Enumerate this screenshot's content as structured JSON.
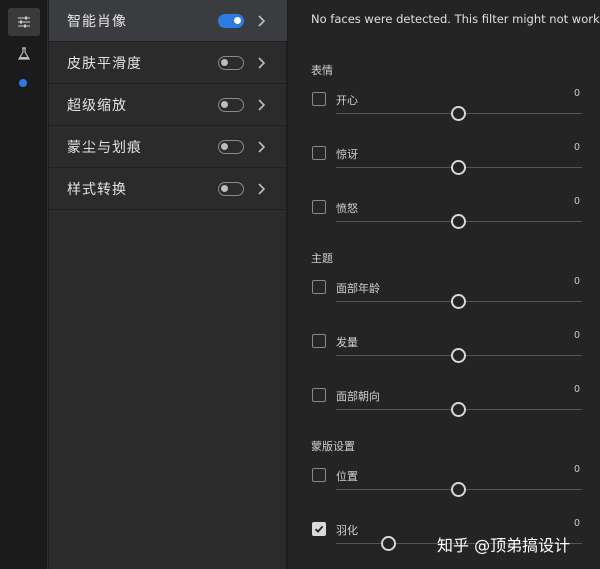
{
  "sidebar": {
    "icons": [
      "sliders-icon",
      "flask-icon",
      "dot-icon"
    ],
    "dot_color": "#2d7be0"
  },
  "filters": [
    {
      "label": "智能肖像",
      "enabled": true,
      "selected": true
    },
    {
      "label": "皮肤平滑度",
      "enabled": false,
      "selected": false
    },
    {
      "label": "超级缩放",
      "enabled": false,
      "selected": false
    },
    {
      "label": "蒙尘与划痕",
      "enabled": false,
      "selected": false
    },
    {
      "label": "样式转换",
      "enabled": false,
      "selected": false
    }
  ],
  "panel": {
    "notice": "No faces were detected. This filter might not work pro",
    "sections": [
      {
        "title": "表情",
        "params": [
          {
            "label": "开心",
            "value": "0",
            "checked": false
          },
          {
            "label": "惊讶",
            "value": "0",
            "checked": false
          },
          {
            "label": "愤怒",
            "value": "0",
            "checked": false
          }
        ]
      },
      {
        "title": "主题",
        "params": [
          {
            "label": "面部年龄",
            "value": "0",
            "checked": false
          },
          {
            "label": "发量",
            "value": "0",
            "checked": false
          },
          {
            "label": "面部朝向",
            "value": "0",
            "checked": false
          }
        ]
      },
      {
        "title": "蒙版设置",
        "params": [
          {
            "label": "位置",
            "value": "0",
            "checked": false
          },
          {
            "label": "羽化",
            "value": "0",
            "checked": true
          }
        ]
      }
    ]
  },
  "watermark": "知乎 @顶弟搞设计",
  "colors": {
    "accent": "#2d7be0",
    "panel_bg": "#242424",
    "list_bg": "#2b2b2b"
  }
}
